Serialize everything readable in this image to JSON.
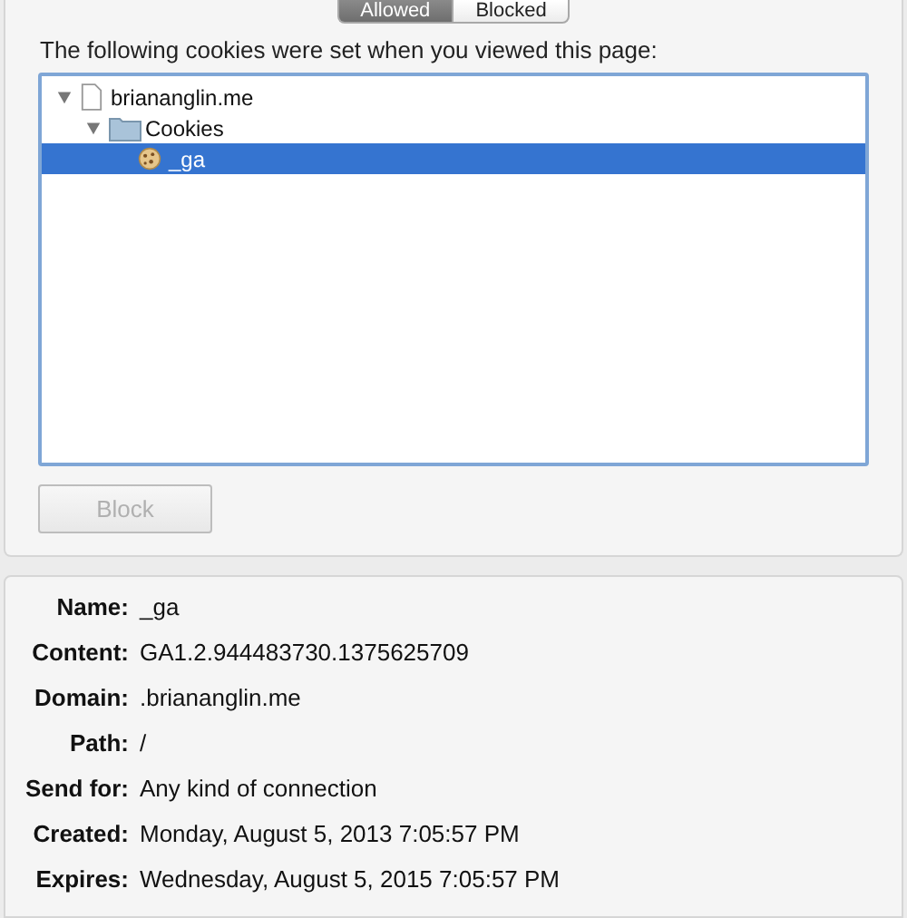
{
  "tabs": [
    {
      "label": "Allowed",
      "selected": true
    },
    {
      "label": "Blocked",
      "selected": false
    }
  ],
  "heading": "The following cookies were set when you viewed this page:",
  "tree": [
    {
      "kind": "site",
      "label": "briananglin.me",
      "expanded": true,
      "selected": false,
      "children": [
        {
          "kind": "folder",
          "label": "Cookies",
          "expanded": true,
          "selected": false,
          "children": [
            {
              "kind": "cookie",
              "label": "_ga",
              "selected": true
            }
          ]
        }
      ]
    }
  ],
  "block_button": {
    "label": "Block",
    "disabled": true
  },
  "details": [
    {
      "label": "Name:",
      "value": "_ga"
    },
    {
      "label": "Content:",
      "value": "GA1.2.944483730.1375625709"
    },
    {
      "label": "Domain:",
      "value": ".briananglin.me"
    },
    {
      "label": "Path:",
      "value": "/"
    },
    {
      "label": "Send for:",
      "value": "Any kind of connection"
    },
    {
      "label": "Created:",
      "value": "Monday, August 5, 2013 7:05:57 PM"
    },
    {
      "label": "Expires:",
      "value": "Wednesday, August 5, 2015 7:05:57 PM"
    }
  ]
}
